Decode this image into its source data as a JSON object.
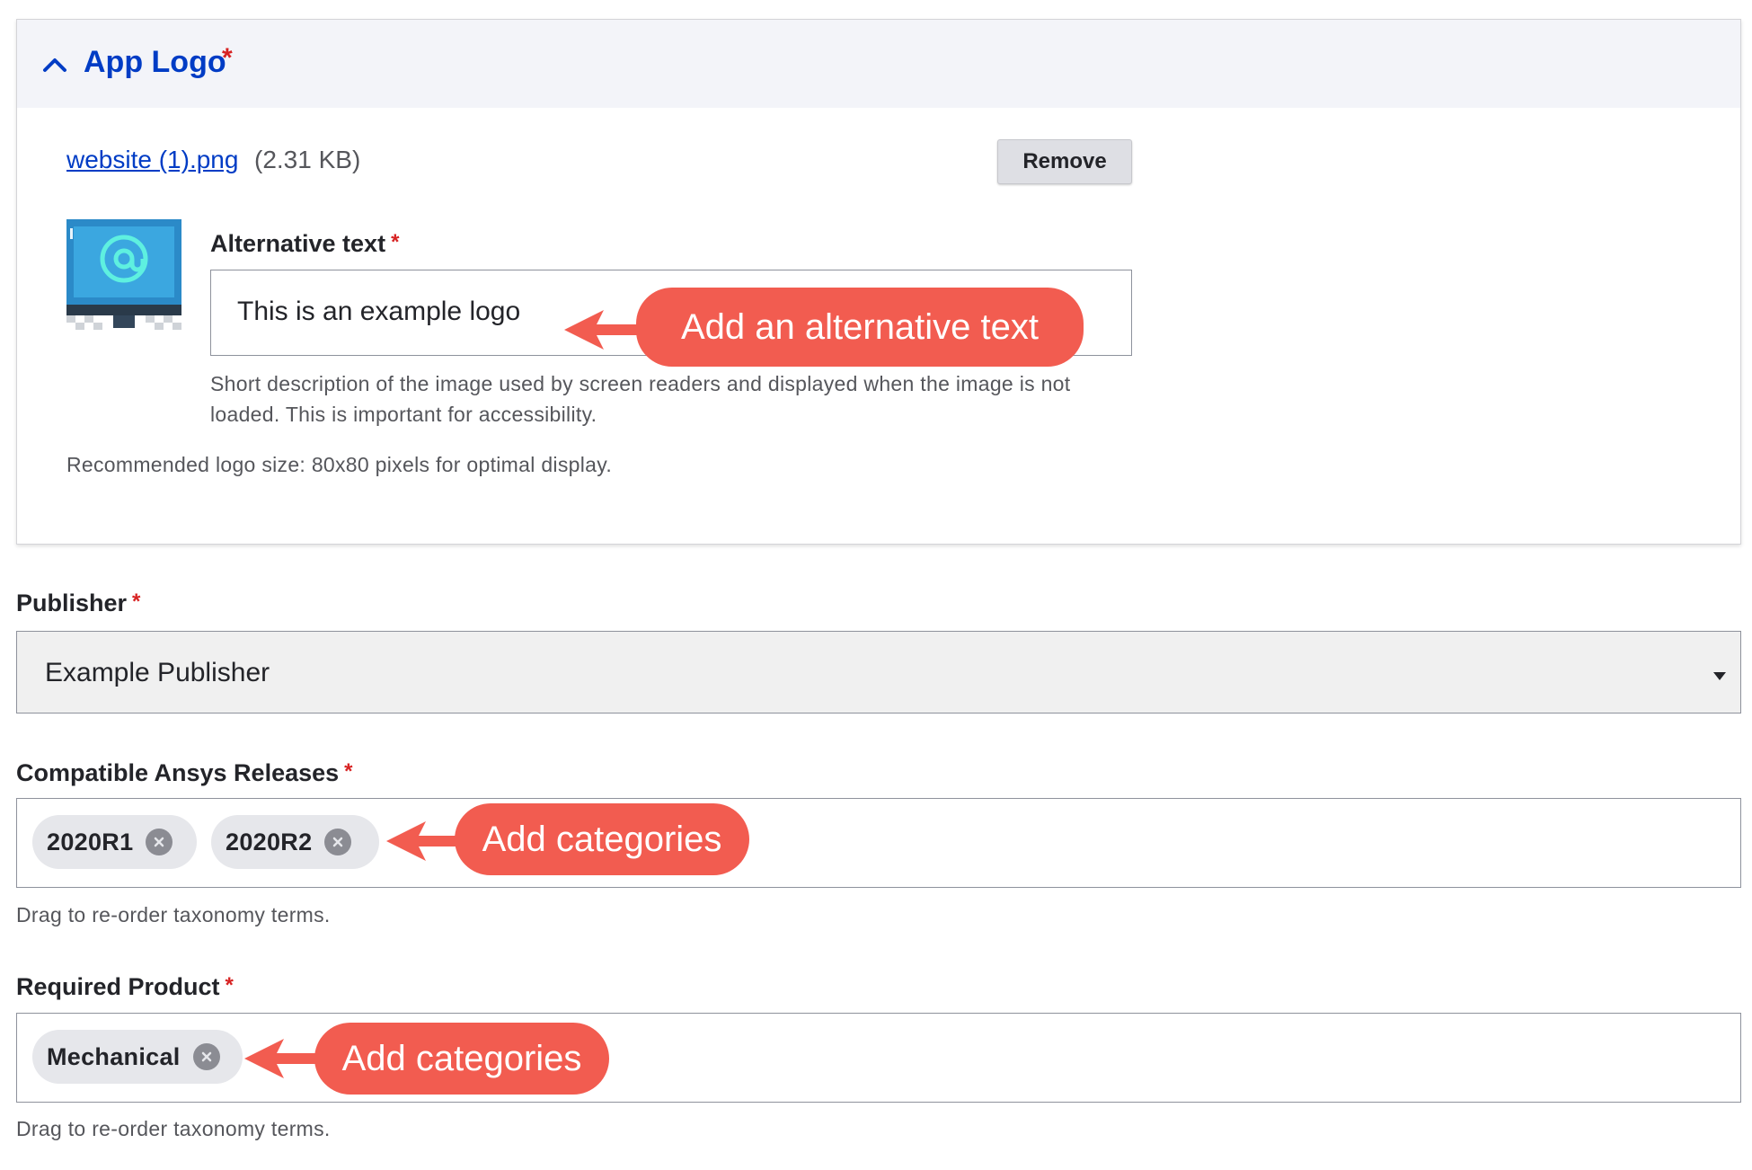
{
  "logo_panel": {
    "title": "App Logo",
    "required_mark": "*",
    "file": {
      "name": "website (1).png",
      "size": "(2.31 KB)"
    },
    "remove_label": "Remove",
    "alt": {
      "label": "Alternative text",
      "value": "This is an example logo",
      "help": "Short description of the image used by screen readers and displayed when the image is not loaded. This is important for accessibility."
    },
    "recommendation": "Recommended logo size: 80x80 pixels for optimal display."
  },
  "callouts": {
    "alt_text": "Add an alternative text",
    "releases": "Add categories",
    "product": "Add categories"
  },
  "publisher": {
    "label": "Publisher",
    "value": "Example Publisher"
  },
  "releases": {
    "label": "Compatible Ansys Releases",
    "tags": [
      "2020R1",
      "2020R2"
    ],
    "help": "Drag to re-order taxonomy terms."
  },
  "product": {
    "label": "Required Product",
    "tags": [
      "Mechanical"
    ],
    "help": "Drag to re-order taxonomy terms."
  },
  "colors": {
    "link": "#003cc5",
    "required": "#d72222",
    "callout": "#f25c50"
  }
}
